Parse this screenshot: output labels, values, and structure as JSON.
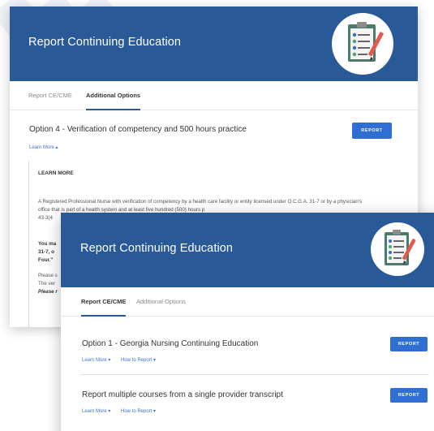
{
  "colors": {
    "header_bg": "#2a5998",
    "button_bg": "#2f6fd3",
    "link": "#3a74c9"
  },
  "back_card": {
    "header": {
      "title": "Report Continuing Education",
      "logo_icon": "clipboard-checklist-icon"
    },
    "tabs": [
      {
        "label": "Report CE/CME",
        "active": false
      },
      {
        "label": "Additional Options",
        "active": true
      }
    ],
    "option": {
      "title": "Option 4 - Verification of competency and 500 hours practice",
      "button_label": "REPORT",
      "learn_more_link": "Learn More ▴"
    },
    "learn_more": {
      "heading": "LEARN MORE",
      "body": "A Registered Professional Nurse with verification of competency by a health care facility or entity licensed under O.C.G.A. 31-7 or by a physician's office that is part of a health system and at least five hundred (500) hours p",
      "body_tail": "43-3(4",
      "bold_text": "You ma",
      "bold_text_2": "31-7, o",
      "bold_text_3": "Four.\"",
      "note": "Please s",
      "note_2": "The ver",
      "note_3": "Please r"
    }
  },
  "front_card": {
    "header": {
      "title": "Report Continuing Education",
      "logo_icon": "clipboard-checklist-icon"
    },
    "tabs": [
      {
        "label": "Report CE/CME",
        "active": true
      },
      {
        "label": "Additional Options",
        "active": false
      }
    ],
    "options": [
      {
        "title": "Option 1 - Georgia Nursing Continuing Education",
        "button_label": "REPORT",
        "learn_more_link": "Learn More ▾",
        "how_to_link": "How to Report ▾"
      },
      {
        "title": "Report multiple courses from a single provider transcript",
        "button_label": "REPORT",
        "learn_more_link": "Learn More ▾",
        "how_to_link": "How to Report ▾"
      }
    ]
  }
}
